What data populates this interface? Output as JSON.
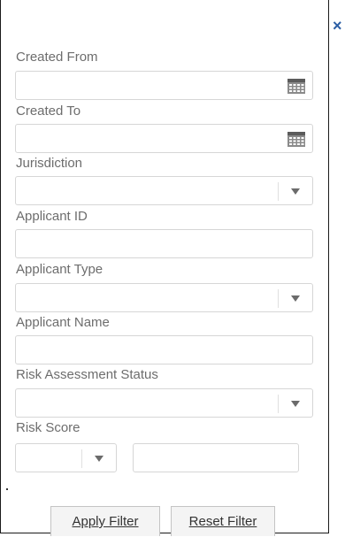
{
  "panel": {
    "close_icon": "close-icon",
    "accent_color": "#2c5fa5"
  },
  "fields": {
    "created_from": {
      "label": "Created From",
      "value": ""
    },
    "created_to": {
      "label": "Created To",
      "value": ""
    },
    "jurisdiction": {
      "label": "Jurisdiction",
      "selected": ""
    },
    "applicant_id": {
      "label": "Applicant ID",
      "value": ""
    },
    "applicant_type": {
      "label": "Applicant Type",
      "selected": ""
    },
    "applicant_name": {
      "label": "Applicant Name",
      "value": ""
    },
    "risk_assessment_status": {
      "label": "Risk Assessment Status",
      "selected": ""
    },
    "risk_score": {
      "label": "Risk Score",
      "operator_selected": "",
      "value": ""
    }
  },
  "buttons": {
    "apply_label": "Apply Filter",
    "reset_label": "Reset Filter"
  }
}
